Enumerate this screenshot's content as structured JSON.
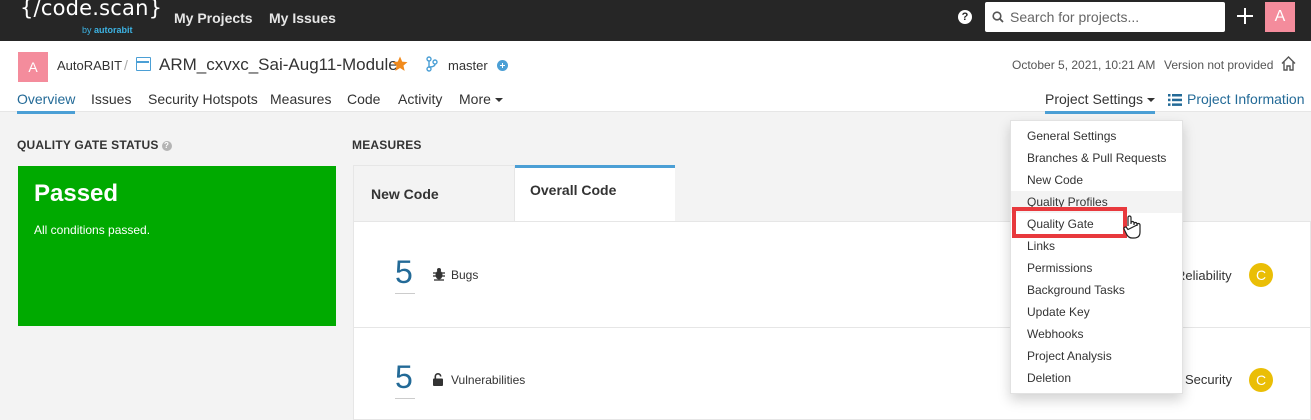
{
  "topbar": {
    "logo_text": "{/code.scan}",
    "logo_sub_prefix": "by ",
    "logo_sub_brand": "autorabit",
    "nav": [
      "My Projects",
      "My Issues"
    ],
    "help_label": "?",
    "search_placeholder": "Search for projects...",
    "user_initial": "A"
  },
  "project": {
    "org_initial": "A",
    "org_name": "AutoRABIT",
    "separator": "/",
    "name": "ARM_cxvxc_Sai-Aug11-Module",
    "branch": "master",
    "date": "October 5, 2021, 10:21 AM",
    "version": "Version not provided",
    "tabs": [
      "Overview",
      "Issues",
      "Security Hotspots",
      "Measures",
      "Code",
      "Activity",
      "More"
    ],
    "active_tab": "Overview",
    "settings_label": "Project Settings",
    "info_label": "Project Information"
  },
  "quality_gate": {
    "title": "QUALITY GATE STATUS",
    "status": "Passed",
    "message": "All conditions passed.",
    "color": "#00aa00"
  },
  "measures": {
    "title": "MEASURES",
    "tabs": [
      "New Code",
      "Overall Code"
    ],
    "active_tab": "Overall Code",
    "rows": [
      {
        "value": "5",
        "icon": "bug-icon",
        "label": "Bugs",
        "rating_label": "Reliability",
        "rating": "C"
      },
      {
        "value": "5",
        "icon": "lock-icon",
        "label": "Vulnerabilities",
        "rating_label": "Security",
        "rating": "C"
      }
    ],
    "rating_color": "#eabe06"
  },
  "settings_menu": {
    "items": [
      "General Settings",
      "Branches & Pull Requests",
      "New Code",
      "Quality Profiles",
      "Quality Gate",
      "Links",
      "Permissions",
      "Background Tasks",
      "Update Key",
      "Webhooks",
      "Project Analysis",
      "Deletion"
    ],
    "hovered": "Quality Profiles",
    "highlighted": "Quality Gate",
    "highlight_color": "#e8393d"
  },
  "colors": {
    "topbar": "#262626",
    "accent": "#4b9fd5",
    "link": "#236a97",
    "avatar": "#f48c9c",
    "star": "#f18a1c"
  }
}
